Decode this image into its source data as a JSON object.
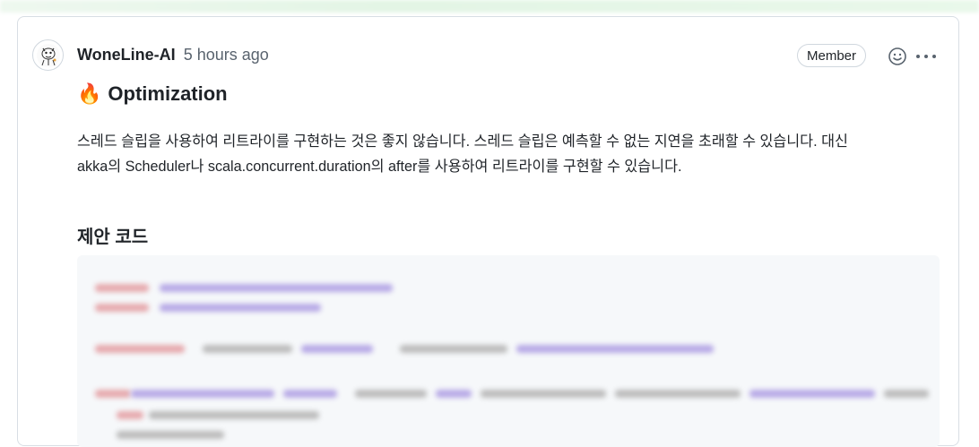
{
  "comment": {
    "author": "WoneLine-AI",
    "time": "5 hours ago",
    "badge": "Member",
    "heading_emoji": "🔥",
    "heading": "Optimization",
    "paragraph_line1": "스레드 슬립을 사용하여 리트라이를 구현하는 것은 좋지 않습니다. 스레드 슬립은 예측할 수 없는 지연을 초래할 수 있습니다. 대신",
    "paragraph_line2": "akka의 Scheduler나 scala.concurrent.duration의 after를 사용하여 리트라이를 구현할 수 있습니다.",
    "subheading": "제안 코드",
    "icons": [
      "avatar",
      "fire-icon",
      "smiley-icon",
      "kebab-icon"
    ]
  },
  "colors": {
    "keyword": "#cf222e",
    "string": "#0a3069",
    "type": "#8250df",
    "border": "#d8dee4"
  }
}
